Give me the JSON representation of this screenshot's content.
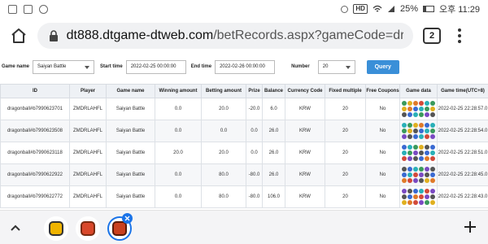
{
  "status_bar": {
    "battery": "25%",
    "time": "오후 11:29",
    "hd": "HD"
  },
  "browser": {
    "url_domain": "dt888.dtgame-dtweb.com",
    "url_path": "/betRecords.aspx?gameCode=dragonball",
    "tab_count": "2"
  },
  "filters": {
    "game_name_label": "Game name",
    "game_name_value": "Saiyan Battle",
    "start_label": "Start time",
    "start_value": "2022-02-25 00:00:00",
    "end_label": "End time",
    "end_value": "2022-02-26 00:00:00",
    "number_label": "Number",
    "number_value": "20",
    "query_label": "Query"
  },
  "table": {
    "headers": [
      "ID",
      "Player",
      "Game name",
      "Winning amount",
      "Betting amount",
      "Prize",
      "Balance",
      "Currency Code",
      "Fixed multiple",
      "Free Coupons",
      "Game data",
      "Game time(UTC+8)"
    ],
    "rows": [
      [
        "dragonball#b7990623701",
        "ZMDRLAHFL",
        "Saiyan Battle",
        "0.0",
        "20.0",
        "-20.0",
        "6.0",
        "KRW",
        "20",
        "No",
        "",
        "2022-02-25 22:28:57.0"
      ],
      [
        "dragonball#b7990623508",
        "ZMDRLAHFL",
        "Saiyan Battle",
        "0.0",
        "0.0",
        "0.0",
        "26.0",
        "KRW",
        "20",
        "No",
        "",
        "2022-02-25 22:28:54.0"
      ],
      [
        "dragonball#b7990623118",
        "ZMDRLAHFL",
        "Saiyan Battle",
        "20.0",
        "20.0",
        "0.0",
        "26.0",
        "KRW",
        "20",
        "No",
        "",
        "2022-02-25 22:28:51.0"
      ],
      [
        "dragonball#b7990622922",
        "ZMDRLAHFL",
        "Saiyan Battle",
        "0.0",
        "80.0",
        "-80.0",
        "26.0",
        "KRW",
        "20",
        "No",
        "",
        "2022-02-25 22:28:45.0"
      ],
      [
        "dragonball#b7990622772",
        "ZMDRLAHFL",
        "Saiyan Battle",
        "0.0",
        "80.0",
        "-80.0",
        "106.0",
        "KRW",
        "20",
        "No",
        "",
        "2022-02-25 22:28:43.0"
      ]
    ]
  },
  "colors": {
    "query_button": "#3a8fd8",
    "header_bg": "#eef1f5",
    "badge_blue": "#1a73e8"
  },
  "icons": {
    "home": "home-icon",
    "lock": "lock-icon",
    "menu": "more-vert-icon",
    "chevron": "chevron-up-icon",
    "plus": "plus-icon"
  }
}
